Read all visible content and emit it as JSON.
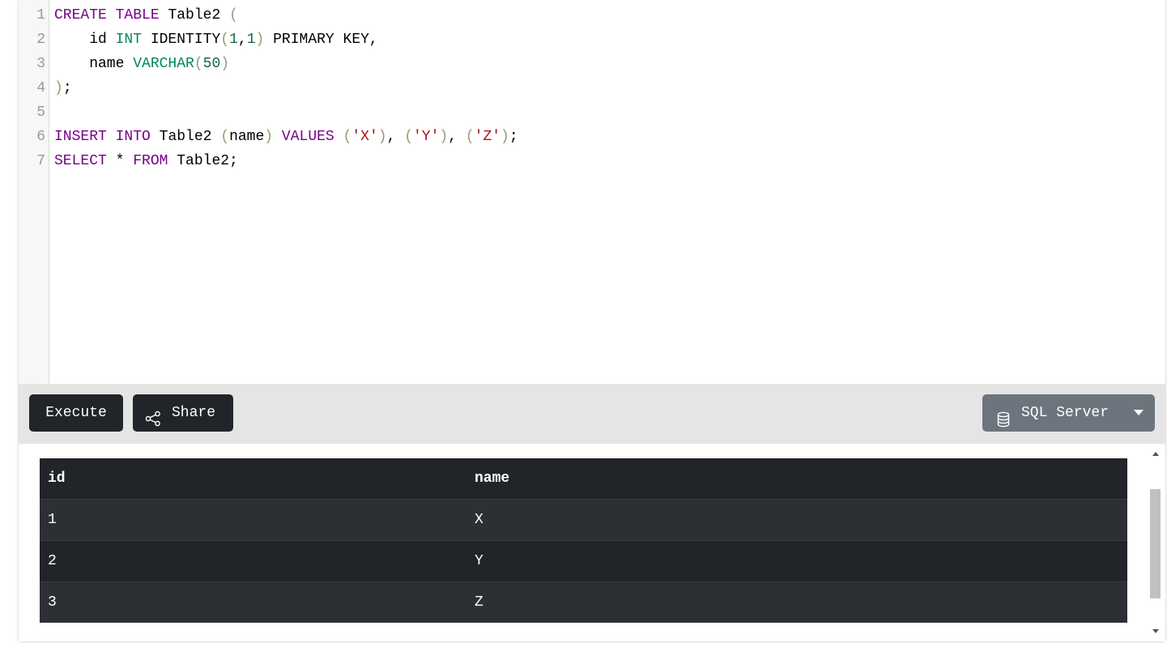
{
  "editor": {
    "lines": [
      {
        "num": "1",
        "tokens": [
          {
            "t": "CREATE",
            "c": "kw"
          },
          {
            "t": " ",
            "c": "pl"
          },
          {
            "t": "TABLE",
            "c": "kw"
          },
          {
            "t": " Table2 ",
            "c": "pl"
          },
          {
            "t": "(",
            "c": "pn"
          }
        ]
      },
      {
        "num": "2",
        "tokens": [
          {
            "t": "    id ",
            "c": "pl"
          },
          {
            "t": "INT",
            "c": "tp"
          },
          {
            "t": " IDENTITY",
            "c": "pl"
          },
          {
            "t": "(",
            "c": "pn"
          },
          {
            "t": "1",
            "c": "nm"
          },
          {
            "t": ",",
            "c": "pl"
          },
          {
            "t": "1",
            "c": "nm"
          },
          {
            "t": ")",
            "c": "pn"
          },
          {
            "t": " PRIMARY KEY,",
            "c": "pl"
          }
        ]
      },
      {
        "num": "3",
        "tokens": [
          {
            "t": "    name ",
            "c": "pl"
          },
          {
            "t": "VARCHAR",
            "c": "tp"
          },
          {
            "t": "(",
            "c": "pn"
          },
          {
            "t": "50",
            "c": "nm"
          },
          {
            "t": ")",
            "c": "pn"
          }
        ]
      },
      {
        "num": "4",
        "tokens": [
          {
            "t": ")",
            "c": "pn"
          },
          {
            "t": ";",
            "c": "pl"
          }
        ]
      },
      {
        "num": "5",
        "tokens": []
      },
      {
        "num": "6",
        "tokens": [
          {
            "t": "INSERT",
            "c": "kw"
          },
          {
            "t": " ",
            "c": "pl"
          },
          {
            "t": "INTO",
            "c": "kw"
          },
          {
            "t": " Table2 ",
            "c": "pl"
          },
          {
            "t": "(",
            "c": "pn"
          },
          {
            "t": "name",
            "c": "pl"
          },
          {
            "t": ")",
            "c": "pn"
          },
          {
            "t": " ",
            "c": "pl"
          },
          {
            "t": "VALUES",
            "c": "kw"
          },
          {
            "t": " ",
            "c": "pl"
          },
          {
            "t": "(",
            "c": "pn"
          },
          {
            "t": "'X'",
            "c": "st"
          },
          {
            "t": ")",
            "c": "pn"
          },
          {
            "t": ", ",
            "c": "pl"
          },
          {
            "t": "(",
            "c": "pn"
          },
          {
            "t": "'Y'",
            "c": "st"
          },
          {
            "t": ")",
            "c": "pn"
          },
          {
            "t": ", ",
            "c": "pl"
          },
          {
            "t": "(",
            "c": "pn"
          },
          {
            "t": "'Z'",
            "c": "st"
          },
          {
            "t": ")",
            "c": "pn"
          },
          {
            "t": ";",
            "c": "pl"
          }
        ]
      },
      {
        "num": "7",
        "tokens": [
          {
            "t": "SELECT",
            "c": "kw"
          },
          {
            "t": " * ",
            "c": "pl"
          },
          {
            "t": "FROM",
            "c": "kw"
          },
          {
            "t": " Table2;",
            "c": "pl"
          }
        ]
      }
    ]
  },
  "toolbar": {
    "execute_label": "Execute",
    "share_label": "Share",
    "db_label": "SQL Server"
  },
  "results": {
    "headers": [
      "id",
      "name"
    ],
    "rows": [
      [
        "1",
        "X"
      ],
      [
        "2",
        "Y"
      ],
      [
        "3",
        "Z"
      ]
    ]
  },
  "colors": {
    "keyword": "#770088",
    "type": "#008855",
    "number": "#116644",
    "string": "#aa1111",
    "button_dark": "#212529",
    "button_db": "#6c757d"
  },
  "icons": {
    "share": "share-icon",
    "database": "database-icon",
    "caret": "caret-down-icon"
  }
}
